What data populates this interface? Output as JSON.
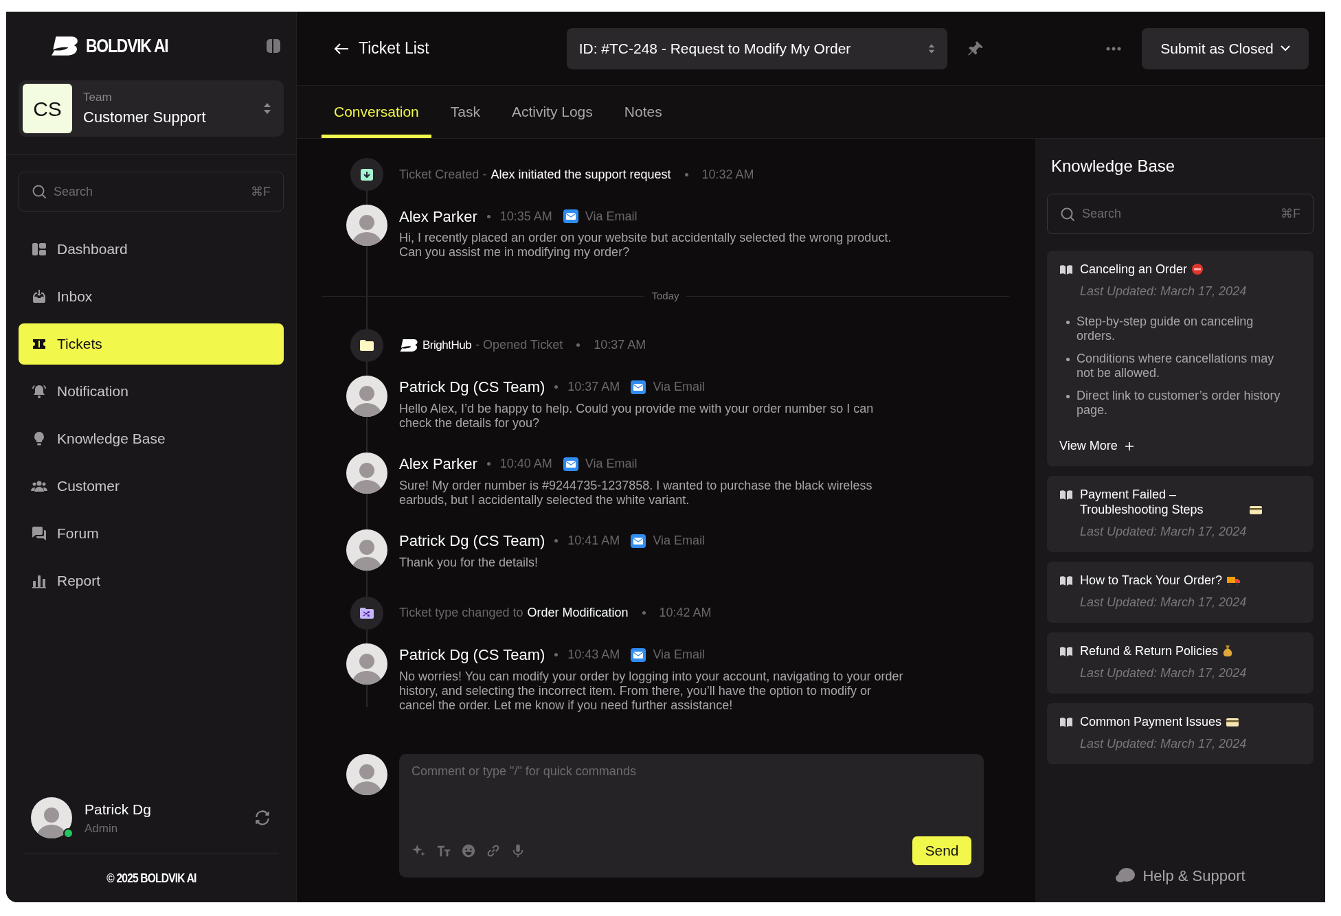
{
  "sidebar": {
    "brand": "BOLDVIK AI",
    "team": {
      "initials": "CS",
      "label": "Team",
      "name": "Customer Support"
    },
    "search": {
      "placeholder": "Search",
      "shortcut": "⌘F"
    },
    "items": [
      {
        "label": "Dashboard",
        "selected": false
      },
      {
        "label": "Inbox",
        "selected": false
      },
      {
        "label": "Tickets",
        "selected": true
      },
      {
        "label": "Notification",
        "selected": false
      },
      {
        "label": "Knowledge Base",
        "selected": false
      },
      {
        "label": "Customer",
        "selected": false
      },
      {
        "label": "Forum",
        "selected": false
      },
      {
        "label": "Report",
        "selected": false
      }
    ],
    "user": {
      "name": "Patrick Dg",
      "role": "Admin",
      "online": true
    },
    "footer": "© 2025 BOLDVIK AI"
  },
  "header": {
    "back": "Ticket List",
    "ticket": "ID: #TC-248 - Request to Modify My Order",
    "submit": "Submit as Closed"
  },
  "tabs": [
    {
      "label": "Conversation",
      "selected": true
    },
    {
      "label": "Task",
      "selected": false
    },
    {
      "label": "Activity Logs",
      "selected": false
    },
    {
      "label": "Notes",
      "selected": false
    }
  ],
  "timeline": [
    {
      "kind": "event",
      "label": "Ticket Created -",
      "detail": "Alex initiated the support request",
      "time": "10:32 AM"
    },
    {
      "kind": "message",
      "author": "Alex Parker",
      "time": "10:35 AM",
      "channel": "Via Email",
      "body": "Hi, I recently placed an order on your website but accidentally selected the wrong product. Can you assist me in modifying my order?"
    },
    {
      "kind": "divider",
      "label": "Today"
    },
    {
      "kind": "event",
      "actor": "BrightHub",
      "label": "- Opened Ticket",
      "time": "10:37 AM"
    },
    {
      "kind": "message",
      "author": "Patrick Dg (CS Team)",
      "time": "10:37 AM",
      "channel": "Via Email",
      "body": "Hello Alex, I’d be happy to help. Could you provide me with your order number so I can check the details for you?"
    },
    {
      "kind": "message",
      "author": "Alex Parker",
      "time": "10:40 AM",
      "channel": "Via Email",
      "body": "Sure! My order number is #9244735-1237858. I wanted to purchase the black wireless earbuds, but I accidentally selected the white variant."
    },
    {
      "kind": "message",
      "author": "Patrick Dg (CS Team)",
      "time": "10:41 AM",
      "channel": "Via Email",
      "body": "Thank you for the details!"
    },
    {
      "kind": "event",
      "label": "Ticket type changed to",
      "detail": "Order Modification",
      "time": "10:42 AM"
    },
    {
      "kind": "message",
      "author": "Patrick Dg (CS Team)",
      "time": "10:43 AM",
      "channel": "Via Email",
      "body": "No worries! You can modify your order by logging into your account, navigating to your order history, and selecting the incorrect item. From there, you’ll have the option to modify or cancel the order. Let me know if you need further assistance!"
    }
  ],
  "composer": {
    "placeholder": "Comment or type \"/\" for quick commands",
    "send": "Send"
  },
  "knowledge_base": {
    "title": "Knowledge Base",
    "search": {
      "placeholder": "Search",
      "shortcut": "⌘F"
    },
    "articles": [
      {
        "title": "Canceling an Order",
        "updated": "Last Updated: March 17, 2024",
        "expanded": true,
        "bullets": [
          "Step-by-step guide on canceling orders.",
          "Conditions where cancellations may not be allowed.",
          "Direct link to customer’s order history page."
        ],
        "more": "View More"
      },
      {
        "title": "Payment Failed – Troubleshooting Steps",
        "updated": "Last Updated: March 17, 2024",
        "expanded": false
      },
      {
        "title": "How to Track Your Order?",
        "updated": "Last Updated: March 17, 2024",
        "expanded": false
      },
      {
        "title": "Refund & Return Policies",
        "updated": "Last Updated: March 17, 2024",
        "expanded": false
      },
      {
        "title": "Common Payment Issues",
        "updated": "Last Updated: March 17, 2024",
        "expanded": false
      }
    ],
    "help": "Help & Support"
  }
}
